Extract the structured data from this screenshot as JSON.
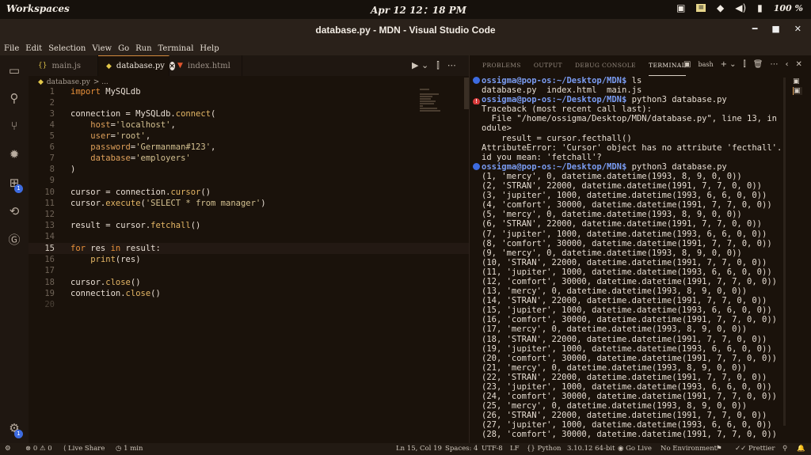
{
  "system": {
    "workspaces": "Workspaces",
    "clock": "Apr 12  12：18 PM",
    "battery": "100 %"
  },
  "window": {
    "title": "database.py - MDN - Visual Studio Code"
  },
  "menu": [
    "File",
    "Edit",
    "Selection",
    "View",
    "Go",
    "Run",
    "Terminal",
    "Help"
  ],
  "tabs": [
    {
      "label": "main.js",
      "icon": "js-file-icon"
    },
    {
      "label": "database.py",
      "icon": "python-file-icon",
      "active": true
    },
    {
      "label": "index.html",
      "icon": "html-file-icon"
    }
  ],
  "breadcrumb": {
    "file": "database.py",
    "rest": "> ..."
  },
  "activity_badges": {
    "extensions": "1",
    "accounts": "1"
  },
  "code": [
    {
      "n": "1",
      "t": "import MySQLdb"
    },
    {
      "n": "2",
      "t": ""
    },
    {
      "n": "3",
      "t": "connection = MySQLdb.connect("
    },
    {
      "n": "4",
      "t": "    host='localhost',"
    },
    {
      "n": "5",
      "t": "    user='root',"
    },
    {
      "n": "6",
      "t": "    password='Germanman#123',"
    },
    {
      "n": "7",
      "t": "    database='employers'"
    },
    {
      "n": "8",
      "t": ")"
    },
    {
      "n": "9",
      "t": ""
    },
    {
      "n": "10",
      "t": "cursor = connection.cursor()"
    },
    {
      "n": "11",
      "t": "cursor.execute('SELECT * from manager')"
    },
    {
      "n": "12",
      "t": ""
    },
    {
      "n": "13",
      "t": "result = cursor.fetchall()"
    },
    {
      "n": "14",
      "t": ""
    },
    {
      "n": "15",
      "t": "for res in result:"
    },
    {
      "n": "16",
      "t": "    print(res)"
    },
    {
      "n": "17",
      "t": ""
    },
    {
      "n": "18",
      "t": "cursor.close()"
    },
    {
      "n": "19",
      "t": "connection.close()"
    },
    {
      "n": "20",
      "t": ""
    }
  ],
  "panel": {
    "tabs": [
      "PROBLEMS",
      "OUTPUT",
      "DEBUG CONSOLE",
      "TERMINAL"
    ],
    "shell": "bash"
  },
  "terminal": [
    {
      "kind": "prompt",
      "dot": "ok",
      "prompt": "ossigma@pop-os:~/Desktop/MDN$",
      "cmd": " ls"
    },
    {
      "kind": "out",
      "t": "database.py  index.html  main.js"
    },
    {
      "kind": "prompt",
      "dot": "err",
      "prompt": "ossigma@pop-os:~/Desktop/MDN$",
      "cmd": " python3 database.py"
    },
    {
      "kind": "out",
      "t": "Traceback (most recent call last):"
    },
    {
      "kind": "out",
      "t": "  File \"/home/ossigma/Desktop/MDN/database.py\", line 13, in <m"
    },
    {
      "kind": "out",
      "t": "odule>"
    },
    {
      "kind": "out",
      "t": "    result = cursor.fecthall()"
    },
    {
      "kind": "out",
      "t": "AttributeError: 'Cursor' object has no attribute 'fecthall'. D"
    },
    {
      "kind": "out",
      "t": "id you mean: 'fetchall'?"
    },
    {
      "kind": "prompt",
      "dot": "ok",
      "prompt": "ossigma@pop-os:~/Desktop/MDN$",
      "cmd": " python3 database.py"
    },
    {
      "kind": "out",
      "t": "(1, 'mercy', 0, datetime.datetime(1993, 8, 9, 0, 0))"
    },
    {
      "kind": "out",
      "t": "(2, 'STRAN', 22000, datetime.datetime(1991, 7, 7, 0, 0))"
    },
    {
      "kind": "out",
      "t": "(3, 'jupiter', 1000, datetime.datetime(1993, 6, 6, 0, 0))"
    },
    {
      "kind": "out",
      "t": "(4, 'comfort', 30000, datetime.datetime(1991, 7, 7, 0, 0))"
    },
    {
      "kind": "out",
      "t": "(5, 'mercy', 0, datetime.datetime(1993, 8, 9, 0, 0))"
    },
    {
      "kind": "out",
      "t": "(6, 'STRAN', 22000, datetime.datetime(1991, 7, 7, 0, 0))"
    },
    {
      "kind": "out",
      "t": "(7, 'jupiter', 1000, datetime.datetime(1993, 6, 6, 0, 0))"
    },
    {
      "kind": "out",
      "t": "(8, 'comfort', 30000, datetime.datetime(1991, 7, 7, 0, 0))"
    },
    {
      "kind": "out",
      "t": "(9, 'mercy', 0, datetime.datetime(1993, 8, 9, 0, 0))"
    },
    {
      "kind": "out",
      "t": "(10, 'STRAN', 22000, datetime.datetime(1991, 7, 7, 0, 0))"
    },
    {
      "kind": "out",
      "t": "(11, 'jupiter', 1000, datetime.datetime(1993, 6, 6, 0, 0))"
    },
    {
      "kind": "out",
      "t": "(12, 'comfort', 30000, datetime.datetime(1991, 7, 7, 0, 0))"
    },
    {
      "kind": "out",
      "t": "(13, 'mercy', 0, datetime.datetime(1993, 8, 9, 0, 0))"
    },
    {
      "kind": "out",
      "t": "(14, 'STRAN', 22000, datetime.datetime(1991, 7, 7, 0, 0))"
    },
    {
      "kind": "out",
      "t": "(15, 'jupiter', 1000, datetime.datetime(1993, 6, 6, 0, 0))"
    },
    {
      "kind": "out",
      "t": "(16, 'comfort', 30000, datetime.datetime(1991, 7, 7, 0, 0))"
    },
    {
      "kind": "out",
      "t": "(17, 'mercy', 0, datetime.datetime(1993, 8, 9, 0, 0))"
    },
    {
      "kind": "out",
      "t": "(18, 'STRAN', 22000, datetime.datetime(1991, 7, 7, 0, 0))"
    },
    {
      "kind": "out",
      "t": "(19, 'jupiter', 1000, datetime.datetime(1993, 6, 6, 0, 0))"
    },
    {
      "kind": "out",
      "t": "(20, 'comfort', 30000, datetime.datetime(1991, 7, 7, 0, 0))"
    },
    {
      "kind": "out",
      "t": "(21, 'mercy', 0, datetime.datetime(1993, 8, 9, 0, 0))"
    },
    {
      "kind": "out",
      "t": "(22, 'STRAN', 22000, datetime.datetime(1991, 7, 7, 0, 0))"
    },
    {
      "kind": "out",
      "t": "(23, 'jupiter', 1000, datetime.datetime(1993, 6, 6, 0, 0))"
    },
    {
      "kind": "out",
      "t": "(24, 'comfort', 30000, datetime.datetime(1991, 7, 7, 0, 0))"
    },
    {
      "kind": "out",
      "t": "(25, 'mercy', 0, datetime.datetime(1993, 8, 9, 0, 0))"
    },
    {
      "kind": "out",
      "t": "(26, 'STRAN', 22000, datetime.datetime(1991, 7, 7, 0, 0))"
    },
    {
      "kind": "out",
      "t": "(27, 'jupiter', 1000, datetime.datetime(1993, 6, 6, 0, 0))"
    },
    {
      "kind": "out",
      "t": "(28, 'comfort', 30000, datetime.datetime(1991, 7, 7, 0, 0))"
    }
  ],
  "status": {
    "problems": "0",
    "warnings": "0",
    "live_share": "Live Share",
    "timer": "1 min",
    "cursor": "Ln 15, Col 19",
    "spaces": "Spaces: 4",
    "encoding": "UTF-8",
    "eol": "LF",
    "language": "Python",
    "interpreter": "3.10.12 64-bit",
    "go_live": "Go Live",
    "environment": "No Environment",
    "prettier": "Prettier"
  },
  "colors": {
    "accent": "#d48a3c",
    "prompt": "#7a9cf2",
    "keyword": "#e8903a"
  }
}
